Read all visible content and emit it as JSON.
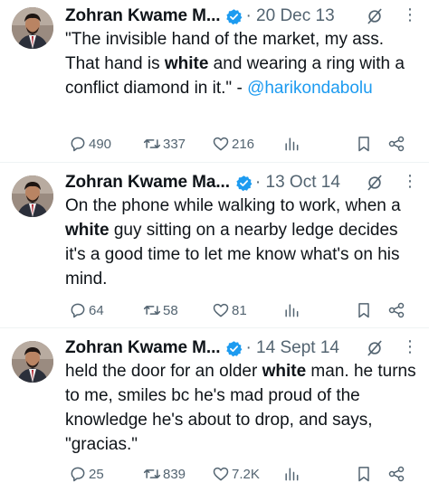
{
  "colors": {
    "text": "#0f1419",
    "muted": "#536471",
    "link": "#1d9bf0",
    "verified": "#1d9bf0",
    "divider": "#eff3f4"
  },
  "tweets": [
    {
      "author": "Zohran Kwame M...",
      "date": "· 20 Dec 13",
      "text_parts": [
        "\"The invisible hand of the market, my ass. That hand is ",
        "white",
        " and wearing a ring with a conflict diamond in it.\" - "
      ],
      "handle": "@harikondabolu",
      "replies": "490",
      "retweets": "337",
      "likes": "216"
    },
    {
      "author": "Zohran Kwame Ma...",
      "date": "· 13 Oct 14",
      "text_parts": [
        "On the phone while walking to work, when a ",
        "white",
        " guy sitting on a nearby ledge decides it's a good time to let me know what's on his mind."
      ],
      "handle": "",
      "replies": "64",
      "retweets": "58",
      "likes": "81"
    },
    {
      "author": "Zohran Kwame M...",
      "date": "· 14 Sept 14",
      "text_parts": [
        "held the door for an older ",
        "white",
        " man. he turns to me, smiles bc he's mad proud of the knowledge he's about to drop, and says, \"gracias.\""
      ],
      "handle": "",
      "replies": "25",
      "retweets": "839",
      "likes": "7.2K"
    }
  ],
  "icons": [
    "verified-badge-icon",
    "grok-icon",
    "more-icon",
    "reply-icon",
    "retweet-icon",
    "like-icon",
    "views-icon",
    "bookmark-icon",
    "share-icon"
  ]
}
